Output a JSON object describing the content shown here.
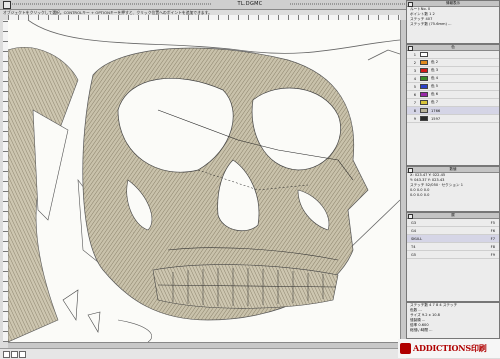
{
  "window": {
    "title": "TL.DGMC"
  },
  "toolbar_hint": "オブジェクトをクリックして選択。CONTROLキー + OPTIONキーを押すと、クリック位置へのポイントを追加できます。",
  "info_panel": {
    "title": "情報表示",
    "lines": [
      "ルートNo. 0",
      "ポイント数 1 2",
      "ステッチ 407",
      "ステッチ数 (75.6mm) ..."
    ]
  },
  "color_panel": {
    "title": "色",
    "rows": [
      {
        "num": "1",
        "label": "",
        "color": "#ffffff"
      },
      {
        "num": "2",
        "label": "色 2",
        "color": "#e08a1e"
      },
      {
        "num": "3",
        "label": "色 3",
        "color": "#d21a1a"
      },
      {
        "num": "4",
        "label": "色 4",
        "color": "#3a8a2a"
      },
      {
        "num": "5",
        "label": "色 5",
        "color": "#2a3fc9"
      },
      {
        "num": "6",
        "label": "色 6",
        "color": "#9a2aa8"
      },
      {
        "num": "7",
        "label": "色 7",
        "color": "#d8c43a"
      },
      {
        "num": "8",
        "label": "1766",
        "color": "#b8b29a"
      },
      {
        "num": "9",
        "label": "1597",
        "color": "#2a2a2a"
      }
    ]
  },
  "tools_panel": {
    "title": "数値",
    "lines": [
      "X: 023.47   Y: 022.45",
      "Y: 043.37   Y: 023.43",
      "ステッチ 52/050 · セクション 1",
      "0.0   0.0   0.0",
      "0.0   0.0   0.0"
    ]
  },
  "layers_panel": {
    "title": "層",
    "rows": [
      {
        "label": "G3",
        "code": "F5"
      },
      {
        "label": "G4",
        "code": "F6"
      },
      {
        "label": "SKULL",
        "code": "F7"
      },
      {
        "label": "T4",
        "code": "F8"
      },
      {
        "label": "G5",
        "code": "F9"
      }
    ]
  },
  "stitch_panel": {
    "lines": [
      "ステッチ数 4 7 8 4 ステッチ",
      "色数 ...",
      "サイズ 9.2 x 10.8",
      "縫製順 ...",
      "倍率 0.600",
      "総縫い時間 ..."
    ]
  },
  "brand": {
    "word": "ADDICTIONS印刷"
  },
  "colors": {
    "thread": "#8d8470",
    "canvas": "#fbfbf8"
  }
}
